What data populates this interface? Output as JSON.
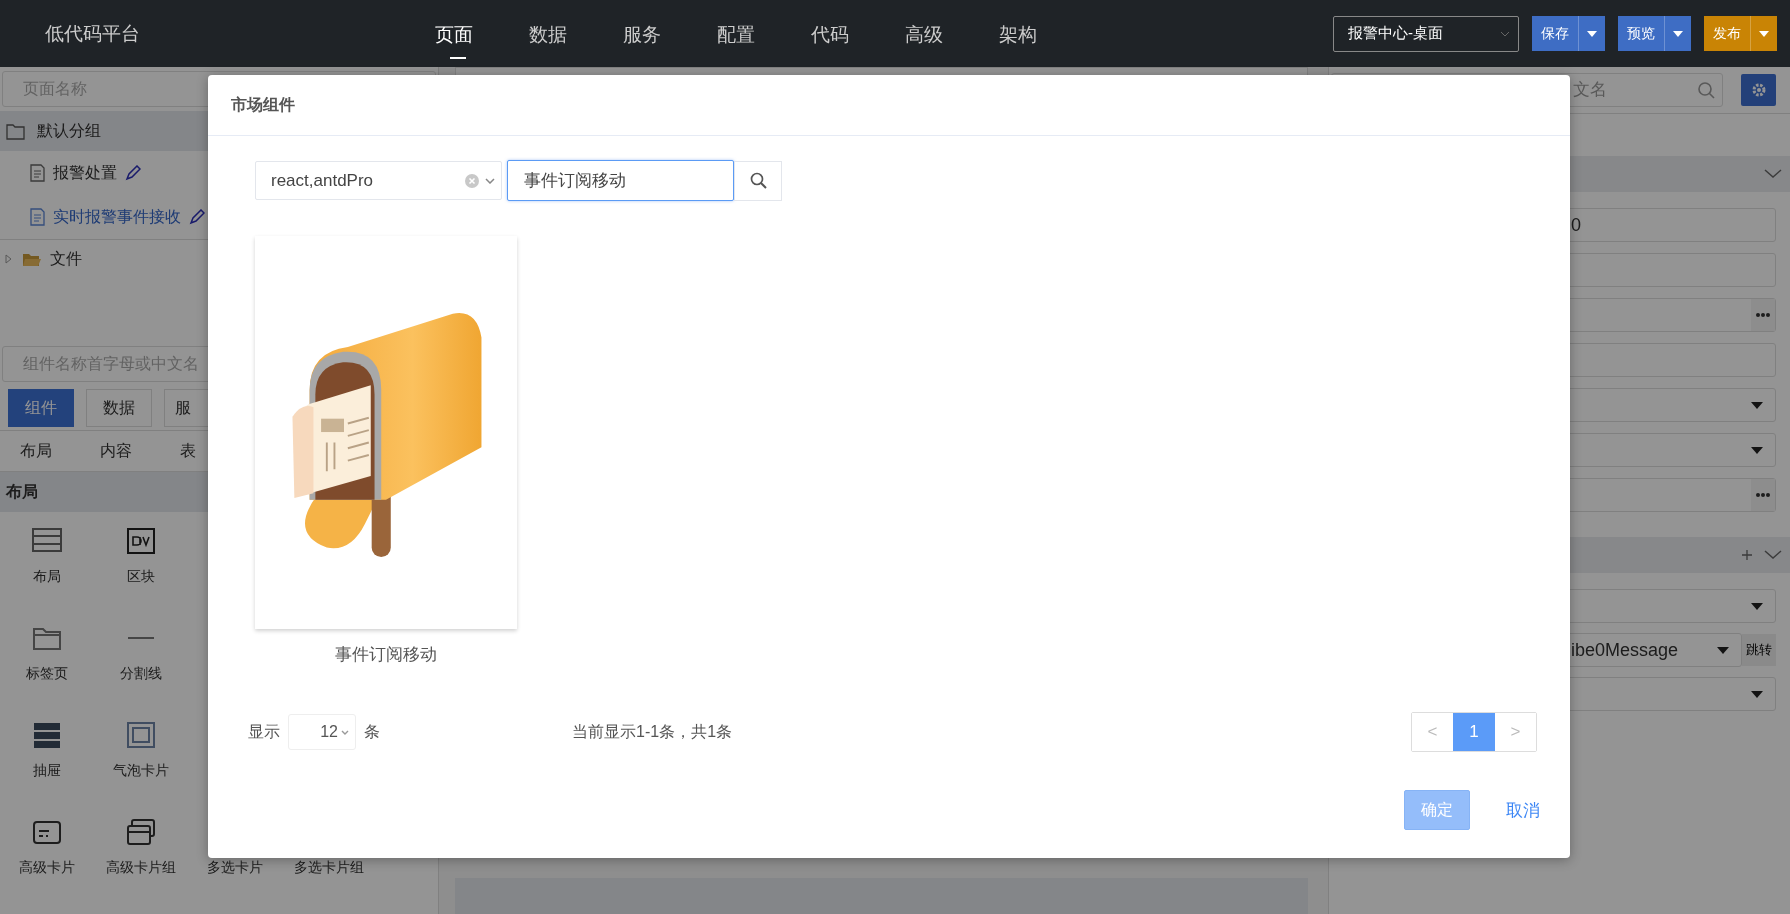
{
  "app": {
    "title": "低代码平台"
  },
  "nav": [
    {
      "label": "页面",
      "selected": true
    },
    {
      "label": "数据",
      "selected": false
    },
    {
      "label": "服务",
      "selected": false
    },
    {
      "label": "配置",
      "selected": false
    },
    {
      "label": "代码",
      "selected": false
    },
    {
      "label": "高级",
      "selected": false
    },
    {
      "label": "架构",
      "selected": false
    }
  ],
  "page_selector": {
    "value": "报警中心-桌面"
  },
  "actions": [
    {
      "label": "保存",
      "color": "#3e6dc4"
    },
    {
      "label": "预览",
      "color": "#3e6dc4"
    },
    {
      "label": "发布",
      "color": "#c98405"
    }
  ],
  "sidebar": {
    "search": {
      "placeholder": "页面名称"
    },
    "group": {
      "label": "默认分组"
    },
    "pages": [
      {
        "label": "报警处置",
        "selected": false
      },
      {
        "label": "实时报警事件接收",
        "selected": true
      }
    ],
    "folder": {
      "label": "文件",
      "expanded": false
    },
    "component_search": {
      "placeholder": "组件名称首字母或中文名"
    },
    "tabs": [
      {
        "label": "组件",
        "selected": true
      },
      {
        "label": "数据",
        "selected": false
      },
      {
        "label": "服",
        "selected": false
      }
    ],
    "categories": [
      "布局",
      "内容",
      "表"
    ],
    "section": "布局",
    "components": [
      {
        "label": "布局",
        "kind": "layout"
      },
      {
        "label": "区块",
        "kind": "div"
      },
      {
        "kind": "none"
      },
      {
        "kind": "none"
      },
      {
        "label": "标签页",
        "kind": "folder"
      },
      {
        "label": "分割线",
        "kind": "divider"
      },
      {
        "kind": "none"
      },
      {
        "kind": "none"
      },
      {
        "label": "抽屉",
        "kind": "drawer"
      },
      {
        "label": "气泡卡片",
        "kind": "frame"
      },
      {
        "kind": "none"
      },
      {
        "kind": "none"
      },
      {
        "label": "高级卡片",
        "kind": "card"
      },
      {
        "label": "高级卡片组",
        "kind": "cards"
      },
      {
        "label": "多选卡片",
        "kind": "check"
      },
      {
        "label": "多选卡片组",
        "kind": "check"
      }
    ]
  },
  "properties": {
    "search": {
      "placeholder": "文名"
    },
    "fields": [
      {
        "kind": "section"
      },
      {
        "kind": "text",
        "value": "0"
      },
      {
        "kind": "text"
      },
      {
        "kind": "picker"
      },
      {
        "kind": "text"
      },
      {
        "kind": "select"
      },
      {
        "kind": "select"
      },
      {
        "kind": "picker"
      },
      {
        "kind": "section-add"
      },
      {
        "kind": "select"
      },
      {
        "kind": "select-jump",
        "value": "ibe0Message",
        "button": "跳转"
      },
      {
        "kind": "select"
      }
    ]
  },
  "modal": {
    "title": "市场组件",
    "framework_select": {
      "value": "react,antdPro"
    },
    "search": {
      "value": "事件订阅移动"
    },
    "results": [
      {
        "name": "事件订阅移动"
      }
    ],
    "page_size": {
      "label": "显示",
      "value": "12",
      "unit": "条"
    },
    "summary": "当前显示1-1条，共1条",
    "pages": [
      {
        "label": "1",
        "selected": true
      }
    ],
    "pager_prev": "<",
    "pager_next": ">",
    "ok": "确定",
    "cancel": "取消"
  }
}
